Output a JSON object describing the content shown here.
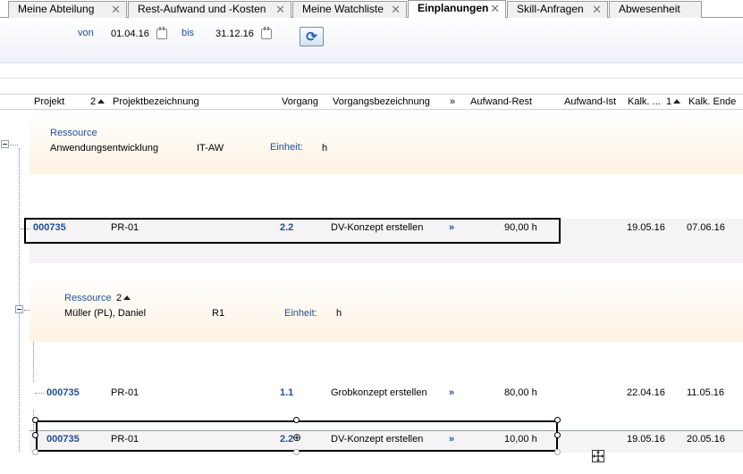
{
  "tabs": [
    {
      "label": "Meine Abteilung"
    },
    {
      "label": "Rest-Aufwand und -Kosten"
    },
    {
      "label": "Meine Watchliste"
    },
    {
      "label": "Einplanungen"
    },
    {
      "label": "Skill-Anfragen"
    },
    {
      "label": "Abwesenheit"
    }
  ],
  "tab_close_glyph": "✕",
  "filter": {
    "from_label": "von",
    "from_value": "01.04.16",
    "to_label": "bis",
    "to_value": "31.12.16",
    "refresh_glyph": "⟳"
  },
  "columns": {
    "projekt": "Projekt",
    "sort_index": "2",
    "projektbezeichnung": "Projektbezeichnung",
    "vorgang": "Vorgang",
    "vorgangsbezeichnung": "Vorgangsbezeichnung",
    "arrow": "»",
    "aufwand_rest": "Aufwand-Rest",
    "aufwand_ist": "Aufwand-Ist",
    "kalk_start": "Kalk. ...",
    "sort_index2": "1",
    "kalk_ende": "Kalk. Ende"
  },
  "groups": [
    {
      "label": "Ressource",
      "name": "Anwendungsentwicklung",
      "code": "IT-AW",
      "unit_label": "Einheit:",
      "unit_value": "h",
      "rows": [
        {
          "projekt": "000735",
          "bezeichnung": "PR-01",
          "vorgang": "2.2",
          "vorgangsbezeichnung": "DV-Konzept erstellen",
          "arrow": "»",
          "aufwand_rest": "90,00 h",
          "aufwand_ist": "",
          "start": "19.05.16",
          "ende": "07.06.16"
        }
      ]
    },
    {
      "label": "Ressource",
      "sort_index": "2",
      "name": "Müller (PL), Daniel",
      "code": "R1",
      "unit_label": "Einheit:",
      "unit_value": "h",
      "rows": [
        {
          "projekt": "000735",
          "bezeichnung": "PR-01",
          "vorgang": "1.1",
          "vorgangsbezeichnung": "Grobkonzept erstellen",
          "arrow": "»",
          "aufwand_rest": "80,00 h",
          "aufwand_ist": "",
          "start": "22.04.16",
          "ende": "11.05.16"
        },
        {
          "projekt": "000735",
          "bezeichnung": "PR-01",
          "vorgang": "2.2",
          "vorgangsbezeichnung": "DV-Konzept erstellen",
          "arrow": "»",
          "aufwand_rest": "10,00 h",
          "aufwand_ist": "",
          "start": "19.05.16",
          "ende": "20.05.16"
        }
      ]
    }
  ],
  "colors": {
    "link_blue": "#1f4e9c",
    "group_band": "#fdf2e2",
    "row_band": "#f5f3f6"
  }
}
